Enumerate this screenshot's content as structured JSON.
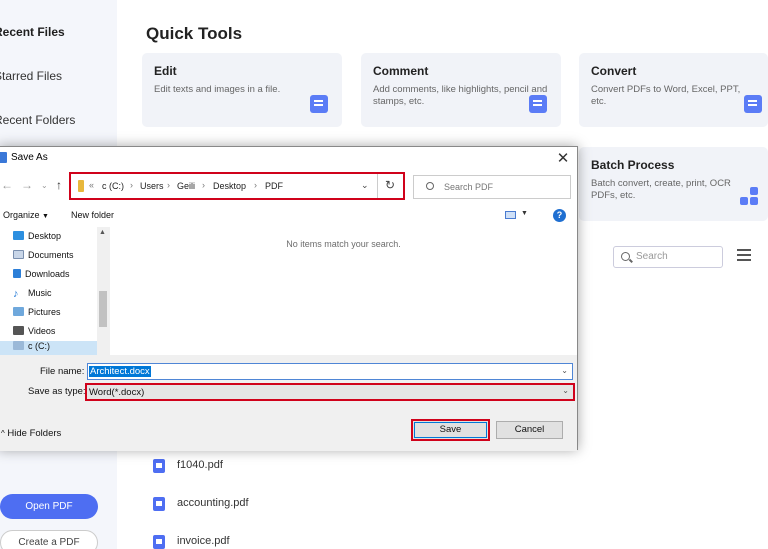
{
  "sidebar": {
    "items": [
      "Recent Files",
      "Starred Files",
      "Recent Folders"
    ],
    "open_pdf": "Open PDF",
    "create_pdf": "Create a PDF"
  },
  "quick_tools": {
    "title": "Quick Tools",
    "cards": [
      {
        "title": "Edit",
        "desc": "Edit texts and images in a file."
      },
      {
        "title": "Comment",
        "desc": "Add comments, like highlights, pencil and stamps, etc."
      },
      {
        "title": "Convert",
        "desc": "Convert PDFs to Word, Excel, PPT, etc."
      },
      {
        "title": "Batch Process",
        "desc": "Batch convert, create, print, OCR PDFs, etc."
      }
    ]
  },
  "recent": {
    "search_placeholder": "Search",
    "files": [
      "f1040.pdf",
      "accounting.pdf",
      "invoice.pdf"
    ]
  },
  "dialog": {
    "title": "Save As",
    "breadcrumb": [
      "c (C:)",
      "Users",
      "Geili",
      "Desktop",
      "PDF"
    ],
    "search_placeholder": "Search PDF",
    "organize_label": "Organize",
    "new_folder_label": "New folder",
    "tree": [
      "Desktop",
      "Documents",
      "Downloads",
      "Music",
      "Pictures",
      "Videos",
      "c (C:)"
    ],
    "empty_message": "No items match your search.",
    "file_name_label": "File name:",
    "file_name_value": "Architect.docx",
    "save_type_label": "Save as type:",
    "save_type_value": "Word(*.docx)",
    "hide_folders_label": "Hide Folders",
    "save_label": "Save",
    "cancel_label": "Cancel"
  },
  "colors": {
    "accent": "#4e6ef2",
    "highlight_border": "#d0021b",
    "selection": "#0078d7"
  }
}
